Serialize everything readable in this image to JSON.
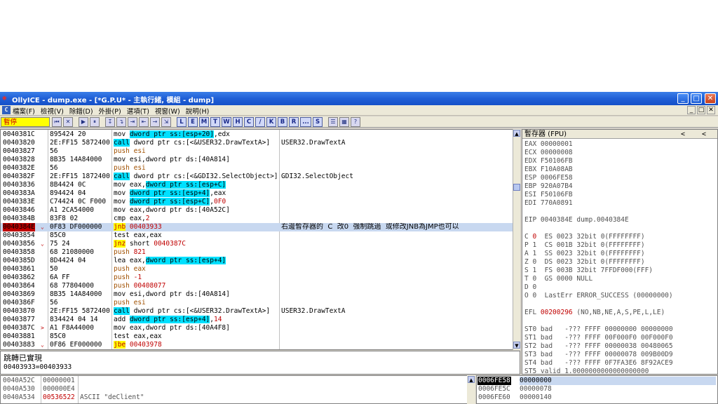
{
  "window": {
    "title": "OllyICE - dump.exe - [*G.P.U* - 主執行緒, 模組 - dump]",
    "controls": {
      "minimize": "_",
      "maximize": "□",
      "close": "✕"
    }
  },
  "menubar": {
    "items": [
      "檔案(F)",
      "檢視(V)",
      "除錯(D)",
      "外掛(P)",
      "選項(T)",
      "視窗(W)",
      "說明(H)"
    ],
    "mdi_controls": [
      "_",
      "□",
      "✕"
    ]
  },
  "toolbar": {
    "status": "暫停",
    "buttons": [
      "⏮",
      "✕",
      "▶",
      "⏸",
      "↧",
      "↴",
      "⇥",
      "⇤",
      "→",
      "⇲"
    ],
    "letters": [
      "L",
      "E",
      "M",
      "T",
      "W",
      "H",
      "C",
      "/",
      "K",
      "B",
      "R",
      "...",
      "S"
    ],
    "extra": [
      "☰",
      "▦",
      "?"
    ]
  },
  "cpu": {
    "rows": [
      {
        "addr": "0040381C",
        "hex": "895424 20",
        "dis": [
          {
            "t": "mov "
          },
          {
            "t": "dword ptr ss:[esp+20]",
            "c": "hl-cyan"
          },
          {
            "t": ",edx"
          }
        ],
        "comment": ""
      },
      {
        "addr": "00403820",
        "hex": "2E:FF15 5872400",
        "dis": [
          {
            "t": "call",
            "c": "kw-call"
          },
          {
            "t": " dword ptr cs:[<&USER32.DrawTextA>]"
          }
        ],
        "comment": "USER32.DrawTextA"
      },
      {
        "addr": "00403827",
        "hex": "56",
        "dis": [
          {
            "t": "push esi",
            "c": "brown"
          }
        ],
        "comment": ""
      },
      {
        "addr": "00403828",
        "hex": "8B35 14A84000",
        "dis": [
          {
            "t": "mov esi,dword ptr ds:[40A814]"
          }
        ],
        "comment": ""
      },
      {
        "addr": "0040382E",
        "hex": "56",
        "dis": [
          {
            "t": "push esi",
            "c": "brown"
          }
        ],
        "comment": ""
      },
      {
        "addr": "0040382F",
        "hex": "2E:FF15 1872400",
        "dis": [
          {
            "t": "call",
            "c": "kw-call"
          },
          {
            "t": " dword ptr cs:[<&GDI32.SelectObject>]"
          }
        ],
        "comment": "GDI32.SelectObject"
      },
      {
        "addr": "00403836",
        "hex": "8B4424 0C",
        "dis": [
          {
            "t": "mov eax,"
          },
          {
            "t": "dword ptr ss:[esp+C]",
            "c": "hl-cyan"
          }
        ],
        "comment": ""
      },
      {
        "addr": "0040383A",
        "hex": "894424 04",
        "dis": [
          {
            "t": "mov "
          },
          {
            "t": "dword ptr ss:[esp+4]",
            "c": "hl-cyan"
          },
          {
            "t": ",eax"
          }
        ],
        "comment": ""
      },
      {
        "addr": "0040383E",
        "hex": "C74424 0C F000",
        "dis": [
          {
            "t": "mov "
          },
          {
            "t": "dword ptr ss:[esp+C]",
            "c": "hl-cyan"
          },
          {
            "t": ","
          },
          {
            "t": "0F0",
            "c": "num"
          }
        ],
        "comment": ""
      },
      {
        "addr": "00403846",
        "hex": "A1 2CA54000",
        "dis": [
          {
            "t": "mov eax,dword ptr ds:[40A52C]"
          }
        ],
        "comment": ""
      },
      {
        "addr": "0040384B",
        "hex": "83F8 02",
        "dis": [
          {
            "t": "cmp eax,"
          },
          {
            "t": "2",
            "c": "num"
          }
        ],
        "comment": ""
      },
      {
        "addr": "0040384E",
        "hex": "0F83 DF000000",
        "dis": [
          {
            "t": "jnb",
            "c": "hl-yellow"
          },
          {
            "t": " "
          },
          {
            "t": "00403933",
            "c": "num"
          }
        ],
        "comment": "右邊暫存器的  C  改0  強制跳過  或修改JNB為JMP也可以",
        "selected": true,
        "mark": "⌄"
      },
      {
        "addr": "00403854",
        "hex": "85C0",
        "dis": [
          {
            "t": "test eax,eax"
          }
        ],
        "comment": ""
      },
      {
        "addr": "00403856",
        "hex": "75 24",
        "dis": [
          {
            "t": "jnz",
            "c": "hl-yellow"
          },
          {
            "t": " short "
          },
          {
            "t": "0040387C",
            "c": "num"
          }
        ],
        "comment": "",
        "mark": "⌄"
      },
      {
        "addr": "00403858",
        "hex": "68 21080000",
        "dis": [
          {
            "t": "push ",
            "c": "brown"
          },
          {
            "t": "821",
            "c": "num"
          }
        ],
        "comment": ""
      },
      {
        "addr": "0040385D",
        "hex": "8D4424 04",
        "dis": [
          {
            "t": "lea eax,"
          },
          {
            "t": "dword ptr ss:[esp+4]",
            "c": "hl-cyan"
          }
        ],
        "comment": ""
      },
      {
        "addr": "00403861",
        "hex": "50",
        "dis": [
          {
            "t": "push eax",
            "c": "brown"
          }
        ],
        "comment": ""
      },
      {
        "addr": "00403862",
        "hex": "6A FF",
        "dis": [
          {
            "t": "push ",
            "c": "brown"
          },
          {
            "t": "-1",
            "c": "num"
          }
        ],
        "comment": ""
      },
      {
        "addr": "00403864",
        "hex": "68 77804000",
        "dis": [
          {
            "t": "push ",
            "c": "brown"
          },
          {
            "t": "00408077",
            "c": "num"
          }
        ],
        "comment": ""
      },
      {
        "addr": "00403869",
        "hex": "8B35 14A84000",
        "dis": [
          {
            "t": "mov esi,dword ptr ds:[40A814]"
          }
        ],
        "comment": ""
      },
      {
        "addr": "0040386F",
        "hex": "56",
        "dis": [
          {
            "t": "push esi",
            "c": "brown"
          }
        ],
        "comment": ""
      },
      {
        "addr": "00403870",
        "hex": "2E:FF15 5872400",
        "dis": [
          {
            "t": "call",
            "c": "kw-call"
          },
          {
            "t": " dword ptr cs:[<&USER32.DrawTextA>]"
          }
        ],
        "comment": "USER32.DrawTextA"
      },
      {
        "addr": "00403877",
        "hex": "834424 04 14",
        "dis": [
          {
            "t": "add "
          },
          {
            "t": "dword ptr ss:[esp+4]",
            "c": "hl-cyan"
          },
          {
            "t": ","
          },
          {
            "t": "14",
            "c": "num"
          }
        ],
        "comment": ""
      },
      {
        "addr": "0040387C",
        "hex": "A1 F8A44000",
        "dis": [
          {
            "t": "mov eax,dword ptr ds:[40A4F8]"
          }
        ],
        "comment": "",
        "mark": ">"
      },
      {
        "addr": "00403881",
        "hex": "85C0",
        "dis": [
          {
            "t": "test eax,eax"
          }
        ],
        "comment": ""
      },
      {
        "addr": "00403883",
        "hex": "0F86 EF000000",
        "dis": [
          {
            "t": "jbe",
            "c": "hl-yellow"
          },
          {
            "t": " "
          },
          {
            "t": "00403978",
            "c": "num"
          }
        ],
        "comment": "",
        "mark": "⌄"
      }
    ]
  },
  "info": {
    "line1": "跳轉已實現",
    "line2": "00403933=00403933"
  },
  "registers": {
    "title": "暫存器 (FPU)",
    "arrows": [
      "<",
      "<"
    ],
    "lines": [
      {
        "t": "EAX 00000001"
      },
      {
        "t": "ECX 00000008"
      },
      {
        "t": "EDX F50106FB"
      },
      {
        "t": "EBX F10A08AB"
      },
      {
        "t": "ESP 0006FE58"
      },
      {
        "t": "EBP 920A07B4"
      },
      {
        "t": "ESI F50106FB"
      },
      {
        "t": "EDI 770A0891"
      },
      {
        "t": ""
      },
      {
        "t": "EIP 0040384E dump.0040384E"
      },
      {
        "t": ""
      },
      {
        "pre": "C ",
        "red": "0",
        "post": "  ES 0023 32bit 0(FFFFFFFF)"
      },
      {
        "t": "P 1  CS 001B 32bit 0(FFFFFFFF)"
      },
      {
        "t": "A 1  SS 0023 32bit 0(FFFFFFFF)"
      },
      {
        "t": "Z 0  DS 0023 32bit 0(FFFFFFFF)"
      },
      {
        "t": "S 1  FS 003B 32bit 7FFDF000(FFF)"
      },
      {
        "t": "T 0  GS 0000 NULL"
      },
      {
        "t": "D 0"
      },
      {
        "t": "O 0  LastErr ERROR_SUCCESS (00000000)"
      },
      {
        "t": ""
      },
      {
        "pre": "EFL ",
        "red": "00200296",
        "post": " (NO,NB,NE,A,S,PE,L,LE)"
      },
      {
        "t": ""
      },
      {
        "t": "ST0 bad   -??? FFFF 00000000 00000000"
      },
      {
        "t": "ST1 bad   -??? FFFF 00F000F0 00F000F0"
      },
      {
        "t": "ST2 bad   -??? FFFF 00000038 00480065"
      },
      {
        "t": "ST3 bad   -??? FFFF 00000078 009B00D9"
      },
      {
        "t": "ST4 bad   -??? FFFF 0F7FA3E6 8F92ACE9"
      },
      {
        "t": "ST5 valid 1.0000000000000000000"
      },
      {
        "t": "ST6 valid 1.0000000000000000000"
      },
      {
        "t": "ST7 valid 1.0000000000000000000"
      }
    ]
  },
  "dump": {
    "rows": [
      {
        "addr": "0040A52C",
        "val": "00000001",
        "ascii": ""
      },
      {
        "addr": "0040A530",
        "val": "000000E4",
        "ascii": ""
      },
      {
        "addr": "0040A534",
        "val": "00536522",
        "ascii": "ASCII \"deClient\"",
        "red": true
      }
    ]
  },
  "stack": {
    "rows": [
      {
        "addr": "0006FE58",
        "val": "00000000",
        "current": true
      },
      {
        "addr": "0006FE5C",
        "val": "00000078"
      },
      {
        "addr": "0006FE60",
        "val": "00000140"
      }
    ]
  }
}
